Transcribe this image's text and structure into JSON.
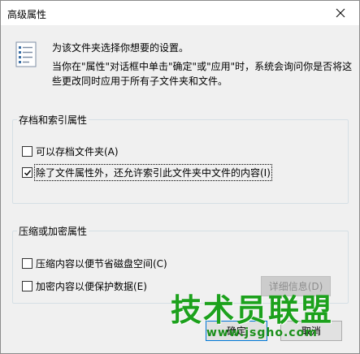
{
  "window": {
    "title": "高级属性"
  },
  "info": {
    "line1": "为该文件夹选择你想要的设置。",
    "line2": "当你在\"属性\"对话框中单击\"确定\"或\"应用\"时，系统会询问你是否将这",
    "line3": "些更改同时应用于所有子文件夹和文件。"
  },
  "archive_group": {
    "label": "存档和索引属性",
    "options": [
      {
        "label": "可以存档文件夹(A)",
        "checked": false
      },
      {
        "label": "除了文件属性外，还允许索引此文件夹中文件的内容(I)",
        "checked": true
      }
    ]
  },
  "compress_group": {
    "label": "压缩或加密属性",
    "options": [
      {
        "label": "压缩内容以便节省磁盘空间(C)",
        "checked": false
      },
      {
        "label": "加密内容以便保护数据(E)",
        "checked": false
      }
    ],
    "details_button": "详细信息(D)"
  },
  "buttons": {
    "ok": "确定",
    "cancel": "取消"
  },
  "watermark": {
    "title": "技术员联盟",
    "url": "www.jsgho.com"
  }
}
